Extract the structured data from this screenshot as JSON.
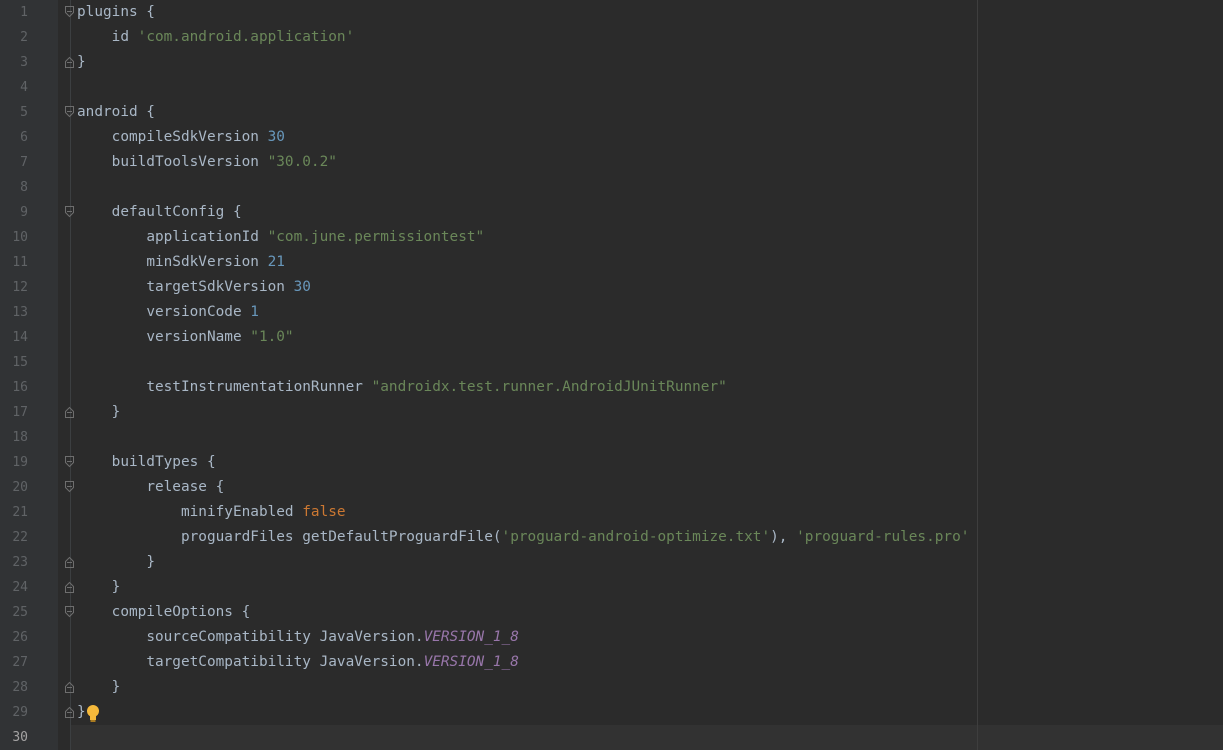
{
  "editor": {
    "lines": [
      {
        "number": "1",
        "indent": "",
        "tokens": [
          {
            "t": "plugins {",
            "k": "p"
          }
        ],
        "fold": "start"
      },
      {
        "number": "2",
        "indent": "    ",
        "tokens": [
          {
            "t": "id ",
            "k": "p"
          },
          {
            "t": "'com.android.application'",
            "k": "s"
          }
        ],
        "fold": ""
      },
      {
        "number": "3",
        "indent": "",
        "tokens": [
          {
            "t": "}",
            "k": "p"
          }
        ],
        "fold": "end"
      },
      {
        "number": "4",
        "indent": "",
        "tokens": [],
        "fold": ""
      },
      {
        "number": "5",
        "indent": "",
        "tokens": [
          {
            "t": "android {",
            "k": "p"
          }
        ],
        "fold": "start"
      },
      {
        "number": "6",
        "indent": "    ",
        "tokens": [
          {
            "t": "compileSdkVersion ",
            "k": "p"
          },
          {
            "t": "30",
            "k": "n"
          }
        ],
        "fold": ""
      },
      {
        "number": "7",
        "indent": "    ",
        "tokens": [
          {
            "t": "buildToolsVersion ",
            "k": "p"
          },
          {
            "t": "\"30.0.2\"",
            "k": "s"
          }
        ],
        "fold": ""
      },
      {
        "number": "8",
        "indent": "",
        "tokens": [],
        "fold": ""
      },
      {
        "number": "9",
        "indent": "    ",
        "tokens": [
          {
            "t": "defaultConfig {",
            "k": "p"
          }
        ],
        "fold": "start"
      },
      {
        "number": "10",
        "indent": "        ",
        "tokens": [
          {
            "t": "applicationId ",
            "k": "p"
          },
          {
            "t": "\"com.june.permissiontest\"",
            "k": "s"
          }
        ],
        "fold": ""
      },
      {
        "number": "11",
        "indent": "        ",
        "tokens": [
          {
            "t": "minSdkVersion ",
            "k": "p"
          },
          {
            "t": "21",
            "k": "n"
          }
        ],
        "fold": ""
      },
      {
        "number": "12",
        "indent": "        ",
        "tokens": [
          {
            "t": "targetSdkVersion ",
            "k": "p"
          },
          {
            "t": "30",
            "k": "n"
          }
        ],
        "fold": ""
      },
      {
        "number": "13",
        "indent": "        ",
        "tokens": [
          {
            "t": "versionCode ",
            "k": "p"
          },
          {
            "t": "1",
            "k": "n"
          }
        ],
        "fold": ""
      },
      {
        "number": "14",
        "indent": "        ",
        "tokens": [
          {
            "t": "versionName ",
            "k": "p"
          },
          {
            "t": "\"1.0\"",
            "k": "s"
          }
        ],
        "fold": ""
      },
      {
        "number": "15",
        "indent": "",
        "tokens": [],
        "fold": ""
      },
      {
        "number": "16",
        "indent": "        ",
        "tokens": [
          {
            "t": "testInstrumentationRunner ",
            "k": "p"
          },
          {
            "t": "\"androidx.test.runner.AndroidJUnitRunner\"",
            "k": "s"
          }
        ],
        "fold": ""
      },
      {
        "number": "17",
        "indent": "    ",
        "tokens": [
          {
            "t": "}",
            "k": "p"
          }
        ],
        "fold": "end"
      },
      {
        "number": "18",
        "indent": "",
        "tokens": [],
        "fold": ""
      },
      {
        "number": "19",
        "indent": "    ",
        "tokens": [
          {
            "t": "buildTypes {",
            "k": "p"
          }
        ],
        "fold": "start"
      },
      {
        "number": "20",
        "indent": "        ",
        "tokens": [
          {
            "t": "release {",
            "k": "p"
          }
        ],
        "fold": "start"
      },
      {
        "number": "21",
        "indent": "            ",
        "tokens": [
          {
            "t": "minifyEnabled ",
            "k": "p"
          },
          {
            "t": "false",
            "k": "k"
          }
        ],
        "fold": ""
      },
      {
        "number": "22",
        "indent": "            ",
        "tokens": [
          {
            "t": "proguardFiles getDefaultProguardFile(",
            "k": "p"
          },
          {
            "t": "'proguard-android-optimize.txt'",
            "k": "s"
          },
          {
            "t": "), ",
            "k": "p"
          },
          {
            "t": "'proguard-rules.pro'",
            "k": "s"
          }
        ],
        "fold": ""
      },
      {
        "number": "23",
        "indent": "        ",
        "tokens": [
          {
            "t": "}",
            "k": "p"
          }
        ],
        "fold": "end"
      },
      {
        "number": "24",
        "indent": "    ",
        "tokens": [
          {
            "t": "}",
            "k": "p"
          }
        ],
        "fold": "end"
      },
      {
        "number": "25",
        "indent": "    ",
        "tokens": [
          {
            "t": "compileOptions {",
            "k": "p"
          }
        ],
        "fold": "start"
      },
      {
        "number": "26",
        "indent": "        ",
        "tokens": [
          {
            "t": "sourceCompatibility JavaVersion.",
            "k": "p"
          },
          {
            "t": "VERSION_1_8",
            "k": "c"
          }
        ],
        "fold": ""
      },
      {
        "number": "27",
        "indent": "        ",
        "tokens": [
          {
            "t": "targetCompatibility JavaVersion.",
            "k": "p"
          },
          {
            "t": "VERSION_1_8",
            "k": "c"
          }
        ],
        "fold": ""
      },
      {
        "number": "28",
        "indent": "    ",
        "tokens": [
          {
            "t": "}",
            "k": "p"
          }
        ],
        "fold": "end"
      },
      {
        "number": "29",
        "indent": "",
        "tokens": [
          {
            "t": "}",
            "k": "p"
          }
        ],
        "fold": "end",
        "bulb": true
      },
      {
        "number": "30",
        "indent": "",
        "tokens": [],
        "fold": "",
        "current": true
      }
    ]
  },
  "colors": {
    "background": "#2b2b2b",
    "gutter": "#313335",
    "plain": "#a9b7c6",
    "string": "#6a8759",
    "number": "#6897bb",
    "keyword": "#cc7832",
    "constant": "#9876aa",
    "line_number": "#606366",
    "bulb": "#f5b93b"
  },
  "icons": {
    "fold_start": "fold-start-icon",
    "fold_end": "fold-end-icon",
    "bulb": "lightbulb-icon"
  }
}
